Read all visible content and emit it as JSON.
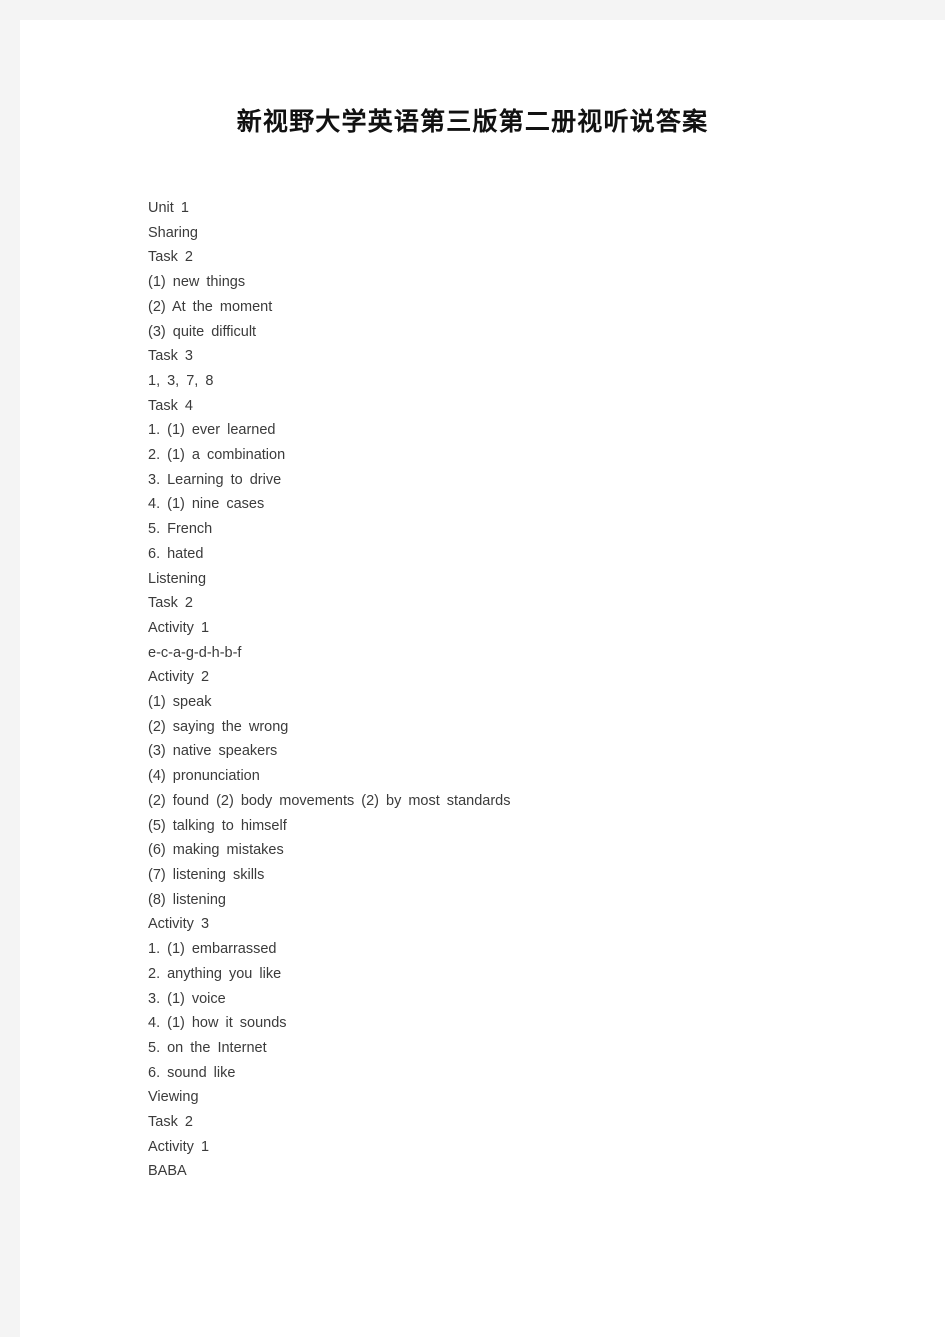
{
  "page": {
    "title": "新视野大学英语第三版第二册视听说答案",
    "background_color": "#f4f4f4",
    "paper_color": "#ffffff",
    "text_color": "#3b3b3b",
    "title_color": "#111111"
  },
  "content": {
    "lines": [
      "Unit 1",
      "Sharing",
      "Task 2",
      "(1) new things",
      "(2) At the moment",
      "(3) quite difficult",
      "Task 3",
      "1, 3, 7, 8",
      "Task 4",
      "1. (1) ever learned",
      "2. (1) a combination",
      "3. Learning to drive",
      "4. (1) nine cases",
      "5. French",
      "6. hated",
      "Listening",
      "Task 2",
      "Activity 1",
      "e-c-a-g-d-h-b-f",
      "Activity 2",
      "(1) speak",
      "(2) saying the wrong",
      "(3) native speakers",
      "(4) pronunciation",
      "(2) found (2) body movements (2) by most standards",
      "(5) talking to himself",
      "(6) making mistakes",
      "(7) listening skills",
      "(8) listening",
      "Activity 3",
      "1. (1) embarrassed",
      "2. anything you like",
      "3. (1) voice",
      "4. (1) how it sounds",
      "5. on the Internet",
      "6. sound like",
      "Viewing",
      "Task 2",
      "Activity 1",
      "BABA"
    ]
  }
}
